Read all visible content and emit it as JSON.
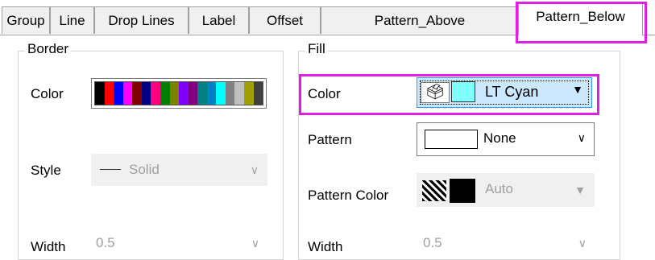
{
  "tabs": [
    {
      "label": "Group"
    },
    {
      "label": "Line"
    },
    {
      "label": "Drop Lines"
    },
    {
      "label": "Label"
    },
    {
      "label": "Offset"
    },
    {
      "label": "Pattern_Above"
    },
    {
      "label": "Pattern_Below",
      "active": true
    }
  ],
  "border": {
    "legend": "Border",
    "color_label": "Color",
    "color_swatches": [
      "#000000",
      "#ff0000",
      "#0000ff",
      "#ff00ff",
      "#800000",
      "#000080",
      "#ff0080",
      "#008000",
      "#808000",
      "#8000ff",
      "#800080",
      "#008080",
      "#0080c0",
      "#00ffff",
      "#808080",
      "#c0c0c0",
      "#a0a000",
      "#404040"
    ],
    "style_label": "Style",
    "style_value": "Solid",
    "width_label": "Width",
    "width_value": "0.5"
  },
  "fill": {
    "legend": "Fill",
    "color_label": "Color",
    "color_value": "LT Cyan",
    "color_hex": "#80ffff",
    "pattern_label": "Pattern",
    "pattern_value": "None",
    "pattern_color_label": "Pattern Color",
    "pattern_color_value": "Auto",
    "width_label": "Width",
    "width_value": "0.5"
  },
  "icons": {
    "bucket": "paint-bucket-icon",
    "dropdown": "chevron-down-icon"
  },
  "highlight_color": "#e020e0"
}
